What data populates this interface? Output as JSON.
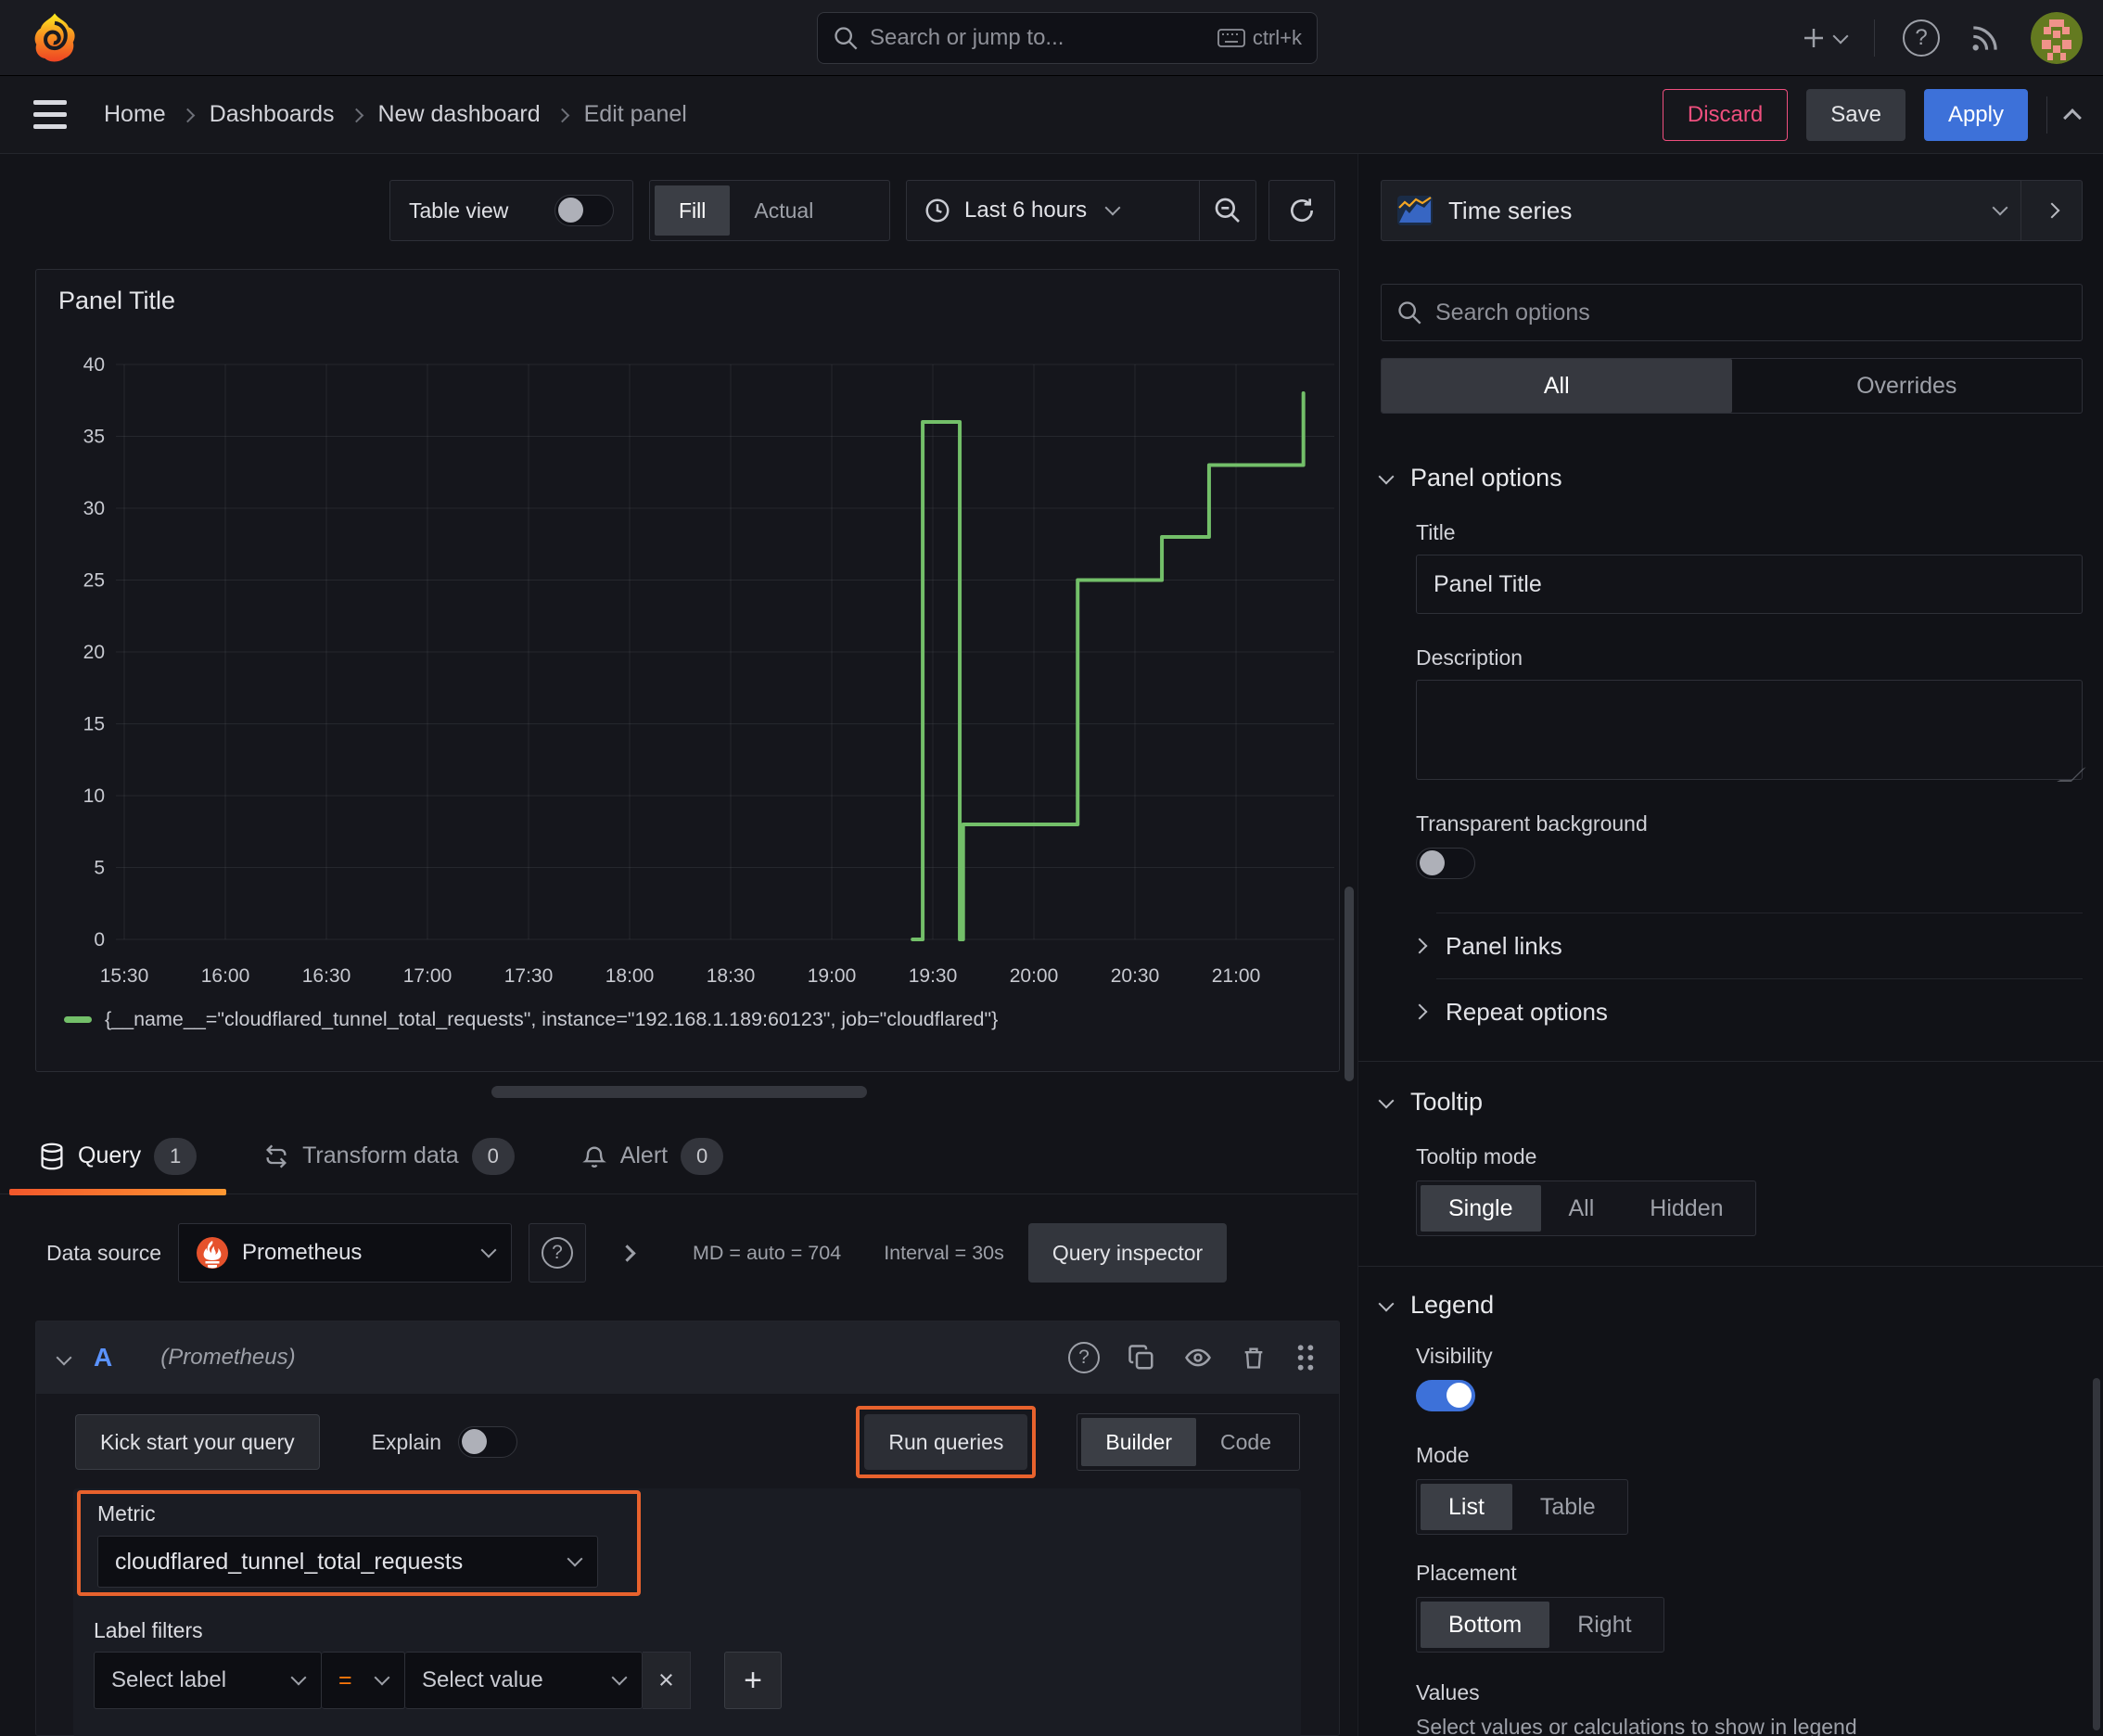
{
  "topnav": {
    "search_placeholder": "Search or jump to...",
    "shortcut": "ctrl+k"
  },
  "breadcrumb": {
    "items": [
      "Home",
      "Dashboards",
      "New dashboard"
    ],
    "current": "Edit panel",
    "discard_label": "Discard",
    "save_label": "Save",
    "apply_label": "Apply"
  },
  "toolbar": {
    "table_view_label": "Table view",
    "fill_label": "Fill",
    "actual_label": "Actual",
    "time_range_label": "Last 6 hours"
  },
  "panel": {
    "title": "Panel Title"
  },
  "chart_data": {
    "type": "line",
    "title": "Panel Title",
    "x_ticks": [
      "15:30",
      "16:00",
      "16:30",
      "17:00",
      "17:30",
      "18:00",
      "18:30",
      "19:00",
      "19:30",
      "20:00",
      "20:30",
      "21:00"
    ],
    "y_ticks": [
      0,
      5,
      10,
      15,
      20,
      25,
      30,
      35,
      40
    ],
    "ylim": [
      0,
      40
    ],
    "grid": true,
    "legend_position": "bottom",
    "series": [
      {
        "name": "{__name__=\"cloudflared_tunnel_total_requests\", instance=\"192.168.1.189:60123\", job=\"cloudflared\"}",
        "color": "#73bf69",
        "step": true,
        "points": [
          [
            "19:24",
            0
          ],
          [
            "19:27",
            36
          ],
          [
            "19:38",
            0
          ],
          [
            "19:39",
            8
          ],
          [
            "20:13",
            25
          ],
          [
            "20:38",
            28
          ],
          [
            "20:52",
            33
          ],
          [
            "21:20",
            38
          ]
        ]
      }
    ]
  },
  "tabs": {
    "query_label": "Query",
    "query_count": "1",
    "transform_label": "Transform data",
    "transform_count": "0",
    "alert_label": "Alert",
    "alert_count": "0"
  },
  "datasource_row": {
    "label": "Data source",
    "value": "Prometheus",
    "stat_md": "MD = auto = 704",
    "stat_interval": "Interval = 30s",
    "inspector_label": "Query inspector"
  },
  "query_a": {
    "letter": "A",
    "datasource_hint": "(Prometheus)",
    "kick_start_label": "Kick start your query",
    "explain_label": "Explain",
    "run_queries_label": "Run queries",
    "builder_label": "Builder",
    "code_label": "Code",
    "metric_label": "Metric",
    "metric_value": "cloudflared_tunnel_total_requests",
    "label_filters_label": "Label filters",
    "select_label_placeholder": "Select label",
    "operator": "=",
    "select_value_placeholder": "Select value"
  },
  "sidebar": {
    "visualization": "Time series",
    "search_placeholder": "Search options",
    "tab_all": "All",
    "tab_overrides": "Overrides",
    "panel_options": {
      "title": "Panel options",
      "title_label": "Title",
      "title_value": "Panel Title",
      "description_label": "Description",
      "transparent_label": "Transparent background"
    },
    "panel_links_label": "Panel links",
    "repeat_options_label": "Repeat options",
    "tooltip": {
      "title": "Tooltip",
      "mode_label": "Tooltip mode",
      "single": "Single",
      "all": "All",
      "hidden": "Hidden"
    },
    "legend": {
      "title": "Legend",
      "visibility_label": "Visibility",
      "mode_label": "Mode",
      "list": "List",
      "table": "Table",
      "placement_label": "Placement",
      "bottom": "Bottom",
      "right": "Right",
      "values_label": "Values",
      "values_help": "Select values or calculations to show in legend"
    }
  },
  "icons": {
    "question": "?",
    "close": "×",
    "plus": "+"
  },
  "colors": {
    "accent_blue": "#3d71d9",
    "series_green": "#73bf69",
    "highlight_orange": "#e8622d",
    "danger_pink": "#ef4f7e"
  }
}
